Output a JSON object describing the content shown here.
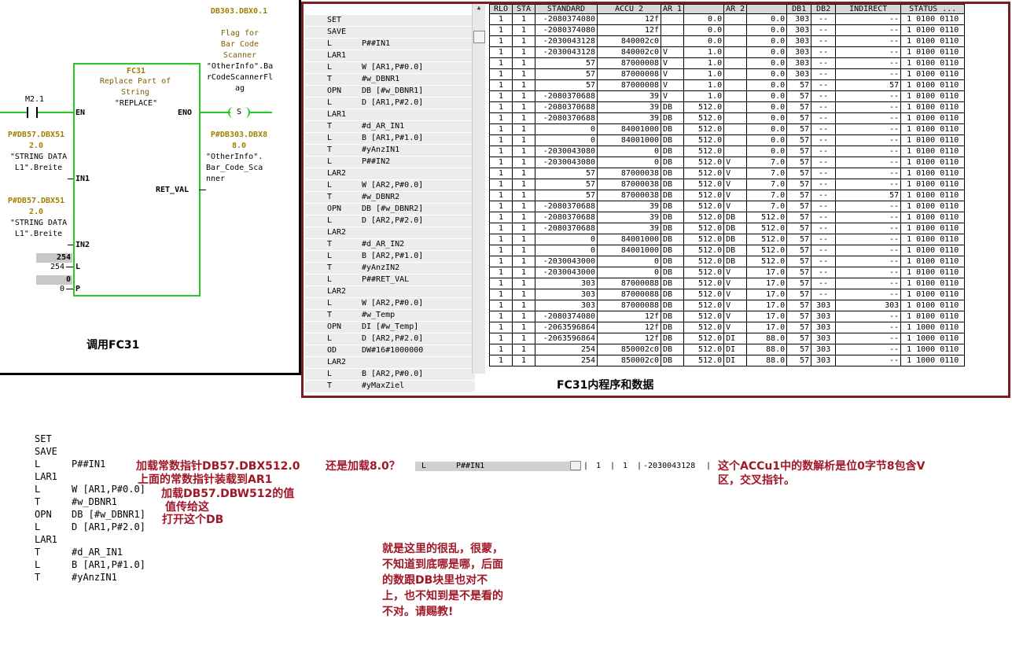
{
  "ladder": {
    "fc_name": "FC31",
    "fc_comment": "Replace Part of String",
    "fc_symbol": "\"REPLACE\"",
    "en_label": "EN",
    "eno_label": "ENO",
    "in1_label": "IN1",
    "in2_label": "IN2",
    "l_label": "L",
    "p_label": "P",
    "ret_label": "RET_VAL",
    "en_contact": "M2.1",
    "flag_addr": "DB303.DBX0.1",
    "flag_comment": "Flag for Bar Code Scanner",
    "flag_symbol": "\"OtherInfo\".BarCodeScannerFlag",
    "coil": "S",
    "in1_addr": "P#DB57.DBX512.0",
    "in1_symbol": "\"STRING DATA L1\".Breite",
    "in2_addr": "P#DB57.DBX512.0",
    "in2_symbol": "\"STRING DATA L1\".Breite",
    "l_mon": "254",
    "l_val": "254",
    "p_mon": "0",
    "p_val": "0",
    "ret_addr": "P#DB303.DBX88.0",
    "ret_symbol": "\"OtherInfo\".Bar_Code_Scanner",
    "caption": "调用FC31"
  },
  "monitor": {
    "caption": "FC31内程序和数据",
    "headers": [
      "RLO",
      "STA",
      "STANDARD",
      "ACCU 2",
      "AR 1",
      "",
      "AR 2",
      "",
      "DB1",
      "DB2",
      "INDIRECT",
      "STATUS ..."
    ],
    "code": [
      [
        "SET",
        ""
      ],
      [
        "SAVE",
        ""
      ],
      [
        "L",
        "P##IN1"
      ],
      [
        "LAR1",
        ""
      ],
      [
        "L",
        "W [AR1,P#0.0]"
      ],
      [
        "T",
        "#w_DBNR1"
      ],
      [
        "OPN",
        "DB [#w_DBNR1]"
      ],
      [
        "L",
        "D [AR1,P#2.0]"
      ],
      [
        "LAR1",
        ""
      ],
      [
        "T",
        "#d_AR_IN1"
      ],
      [
        "L",
        "B [AR1,P#1.0]"
      ],
      [
        "T",
        "#yAnzIN1"
      ],
      [
        "L",
        "P##IN2"
      ],
      [
        "LAR2",
        ""
      ],
      [
        "L",
        "W [AR2,P#0.0]"
      ],
      [
        "T",
        "#w_DBNR2"
      ],
      [
        "OPN",
        "DB [#w_DBNR2]"
      ],
      [
        "L",
        "D [AR2,P#2.0]"
      ],
      [
        "LAR2",
        ""
      ],
      [
        "T",
        "#d_AR_IN2"
      ],
      [
        "L",
        "B [AR2,P#1.0]"
      ],
      [
        "T",
        "#yAnzIN2"
      ],
      [
        "L",
        "P##RET_VAL"
      ],
      [
        "LAR2",
        ""
      ],
      [
        "L",
        "W [AR2,P#0.0]"
      ],
      [
        "T",
        "#w_Temp"
      ],
      [
        "OPN",
        "DI [#w_Temp]"
      ],
      [
        "L",
        "D [AR2,P#2.0]"
      ],
      [
        "OD",
        "DW#16#1000000"
      ],
      [
        "LAR2",
        ""
      ],
      [
        "L",
        "B [AR2,P#0.0]"
      ],
      [
        "T",
        "#yMaxZiel"
      ]
    ],
    "rows": [
      [
        "1",
        "1",
        "-2080374080",
        "12f",
        "",
        "0.0",
        "",
        "0.0",
        "303",
        "--",
        "--",
        "1 0100 0110"
      ],
      [
        "1",
        "1",
        "-2080374080",
        "12f",
        "",
        "0.0",
        "",
        "0.0",
        "303",
        "--",
        "--",
        "1 0100 0110"
      ],
      [
        "1",
        "1",
        "-2030043128",
        "840002c0",
        "",
        "0.0",
        "",
        "0.0",
        "303",
        "--",
        "--",
        "1 0100 0110"
      ],
      [
        "1",
        "1",
        "-2030043128",
        "840002c0",
        "V",
        "1.0",
        "",
        "0.0",
        "303",
        "--",
        "--",
        "1 0100 0110"
      ],
      [
        "1",
        "1",
        "57",
        "87000008",
        "V",
        "1.0",
        "",
        "0.0",
        "303",
        "--",
        "--",
        "1 0100 0110"
      ],
      [
        "1",
        "1",
        "57",
        "87000008",
        "V",
        "1.0",
        "",
        "0.0",
        "303",
        "--",
        "--",
        "1 0100 0110"
      ],
      [
        "1",
        "1",
        "57",
        "87000008",
        "V",
        "1.0",
        "",
        "0.0",
        "57",
        "--",
        "57",
        "1 0100 0110"
      ],
      [
        "1",
        "1",
        "-2080370688",
        "39",
        "V",
        "1.0",
        "",
        "0.0",
        "57",
        "--",
        "--",
        "1 0100 0110"
      ],
      [
        "1",
        "1",
        "-2080370688",
        "39",
        "DB",
        "512.0",
        "",
        "0.0",
        "57",
        "--",
        "--",
        "1 0100 0110"
      ],
      [
        "1",
        "1",
        "-2080370688",
        "39",
        "DB",
        "512.0",
        "",
        "0.0",
        "57",
        "--",
        "--",
        "1 0100 0110"
      ],
      [
        "1",
        "1",
        "0",
        "84001000",
        "DB",
        "512.0",
        "",
        "0.0",
        "57",
        "--",
        "--",
        "1 0100 0110"
      ],
      [
        "1",
        "1",
        "0",
        "84001000",
        "DB",
        "512.0",
        "",
        "0.0",
        "57",
        "--",
        "--",
        "1 0100 0110"
      ],
      [
        "1",
        "1",
        "-2030043080",
        "0",
        "DB",
        "512.0",
        "",
        "0.0",
        "57",
        "--",
        "--",
        "1 0100 0110"
      ],
      [
        "1",
        "1",
        "-2030043080",
        "0",
        "DB",
        "512.0",
        "V",
        "7.0",
        "57",
        "--",
        "--",
        "1 0100 0110"
      ],
      [
        "1",
        "1",
        "57",
        "87000038",
        "DB",
        "512.0",
        "V",
        "7.0",
        "57",
        "--",
        "--",
        "1 0100 0110"
      ],
      [
        "1",
        "1",
        "57",
        "87000038",
        "DB",
        "512.0",
        "V",
        "7.0",
        "57",
        "--",
        "--",
        "1 0100 0110"
      ],
      [
        "1",
        "1",
        "57",
        "87000038",
        "DB",
        "512.0",
        "V",
        "7.0",
        "57",
        "--",
        "57",
        "1 0100 0110"
      ],
      [
        "1",
        "1",
        "-2080370688",
        "39",
        "DB",
        "512.0",
        "V",
        "7.0",
        "57",
        "--",
        "--",
        "1 0100 0110"
      ],
      [
        "1",
        "1",
        "-2080370688",
        "39",
        "DB",
        "512.0",
        "DB",
        "512.0",
        "57",
        "--",
        "--",
        "1 0100 0110"
      ],
      [
        "1",
        "1",
        "-2080370688",
        "39",
        "DB",
        "512.0",
        "DB",
        "512.0",
        "57",
        "--",
        "--",
        "1 0100 0110"
      ],
      [
        "1",
        "1",
        "0",
        "84001000",
        "DB",
        "512.0",
        "DB",
        "512.0",
        "57",
        "--",
        "--",
        "1 0100 0110"
      ],
      [
        "1",
        "1",
        "0",
        "84001000",
        "DB",
        "512.0",
        "DB",
        "512.0",
        "57",
        "--",
        "--",
        "1 0100 0110"
      ],
      [
        "1",
        "1",
        "-2030043000",
        "0",
        "DB",
        "512.0",
        "DB",
        "512.0",
        "57",
        "--",
        "--",
        "1 0100 0110"
      ],
      [
        "1",
        "1",
        "-2030043000",
        "0",
        "DB",
        "512.0",
        "V",
        "17.0",
        "57",
        "--",
        "--",
        "1 0100 0110"
      ],
      [
        "1",
        "1",
        "303",
        "87000088",
        "DB",
        "512.0",
        "V",
        "17.0",
        "57",
        "--",
        "--",
        "1 0100 0110"
      ],
      [
        "1",
        "1",
        "303",
        "87000088",
        "DB",
        "512.0",
        "V",
        "17.0",
        "57",
        "--",
        "--",
        "1 0100 0110"
      ],
      [
        "1",
        "1",
        "303",
        "87000088",
        "DB",
        "512.0",
        "V",
        "17.0",
        "57",
        "303",
        "303",
        "1 0100 0110"
      ],
      [
        "1",
        "1",
        "-2080374080",
        "12f",
        "DB",
        "512.0",
        "V",
        "17.0",
        "57",
        "303",
        "--",
        "1 0100 0110"
      ],
      [
        "1",
        "1",
        "-2063596864",
        "12f",
        "DB",
        "512.0",
        "V",
        "17.0",
        "57",
        "303",
        "--",
        "1 1000 0110"
      ],
      [
        "1",
        "1",
        "-2063596864",
        "12f",
        "DB",
        "512.0",
        "DI",
        "88.0",
        "57",
        "303",
        "--",
        "1 1000 0110"
      ],
      [
        "1",
        "1",
        "254",
        "850002c0",
        "DB",
        "512.0",
        "DI",
        "88.0",
        "57",
        "303",
        "--",
        "1 1000 0110"
      ],
      [
        "1",
        "1",
        "254",
        "850002c0",
        "DB",
        "512.0",
        "DI",
        "88.0",
        "57",
        "303",
        "--",
        "1 1000 0110"
      ]
    ]
  },
  "bottom": {
    "code": [
      [
        "SET",
        ""
      ],
      [
        "SAVE",
        ""
      ],
      [
        "L",
        "P##IN1"
      ],
      [
        "LAR1",
        ""
      ],
      [
        "L",
        "W [AR1,P#0.0]"
      ],
      [
        "T",
        "#w_DBNR1"
      ],
      [
        "OPN",
        "DB [#w_DBNR1]"
      ],
      [
        "L",
        "D [AR1,P#2.0]"
      ],
      [
        "LAR1",
        ""
      ],
      [
        "T",
        "#d_AR_IN1"
      ],
      [
        "L",
        "B [AR1,P#1.0]"
      ],
      [
        "T",
        "#yAnzIN1"
      ]
    ],
    "ann1": "加载常数指针DB57.DBX512.0",
    "ann2": "上面的常数指针装载到AR1",
    "ann3": "加载DB57.DBW512的值",
    "ann4": "值传给这",
    "ann5": "打开这个DB",
    "ann6": "还是加载8.0？",
    "ann7": "这个ACCu1中的数解析是位0字节8包含V区，交叉指针。",
    "ann8": "就是这里的很乱，很蒙，不知道到底哪是哪，后面的数跟DB块里也对不上，也不知到是不是看的不对。请赐教!",
    "mini_op": "L",
    "mini_arg": "P##IN1",
    "mini_rlo": "1",
    "mini_sta": "1",
    "mini_std": "-2030043128"
  }
}
